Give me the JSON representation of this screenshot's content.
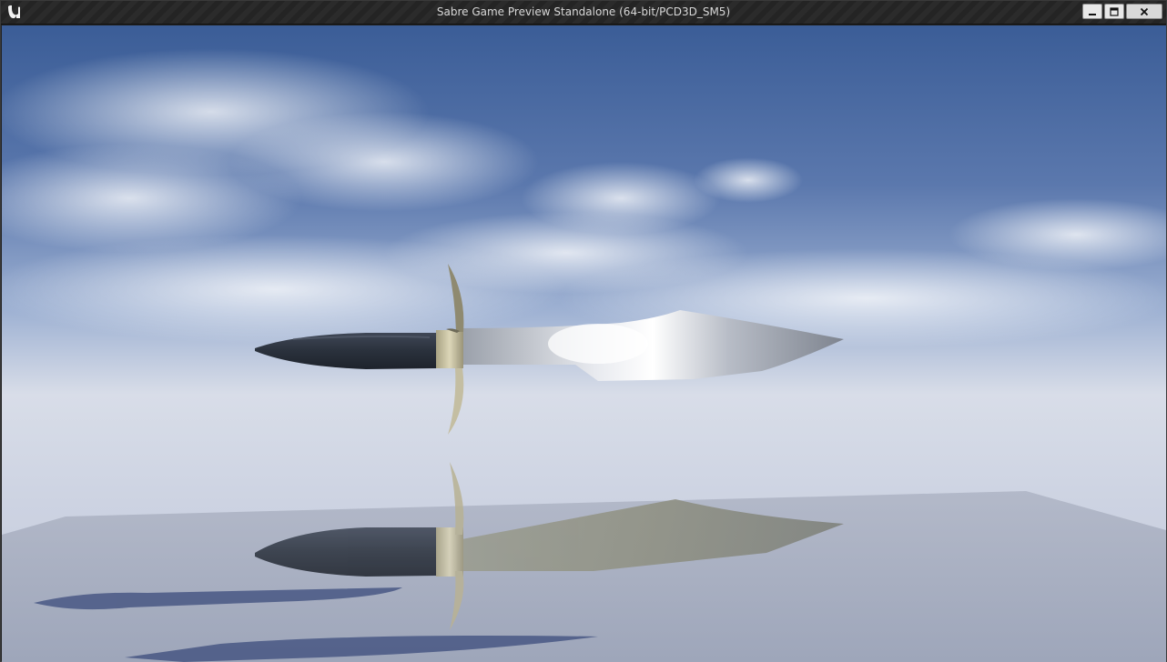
{
  "window": {
    "title": "Sabre Game Preview Standalone (64-bit/PCD3D_SM5)",
    "app_icon": "unreal-engine-logo",
    "controls": {
      "minimize_icon": "minimize-icon",
      "maximize_icon": "maximize-icon",
      "close_icon": "close-icon"
    }
  },
  "viewport": {
    "scene": "3d-preview",
    "objects": [
      "knife-model",
      "knife-reflection",
      "ground-plane",
      "sky"
    ],
    "colors": {
      "sky_top": "#3d5f98",
      "sky_mid": "#7f9bc8",
      "horizon": "#d9dde7",
      "floor": "#a7aec0",
      "handle": "#2e3440",
      "guard": "#c9c2a0",
      "blade_highlight": "#ffffff",
      "shadow": "#3a4a78"
    }
  }
}
